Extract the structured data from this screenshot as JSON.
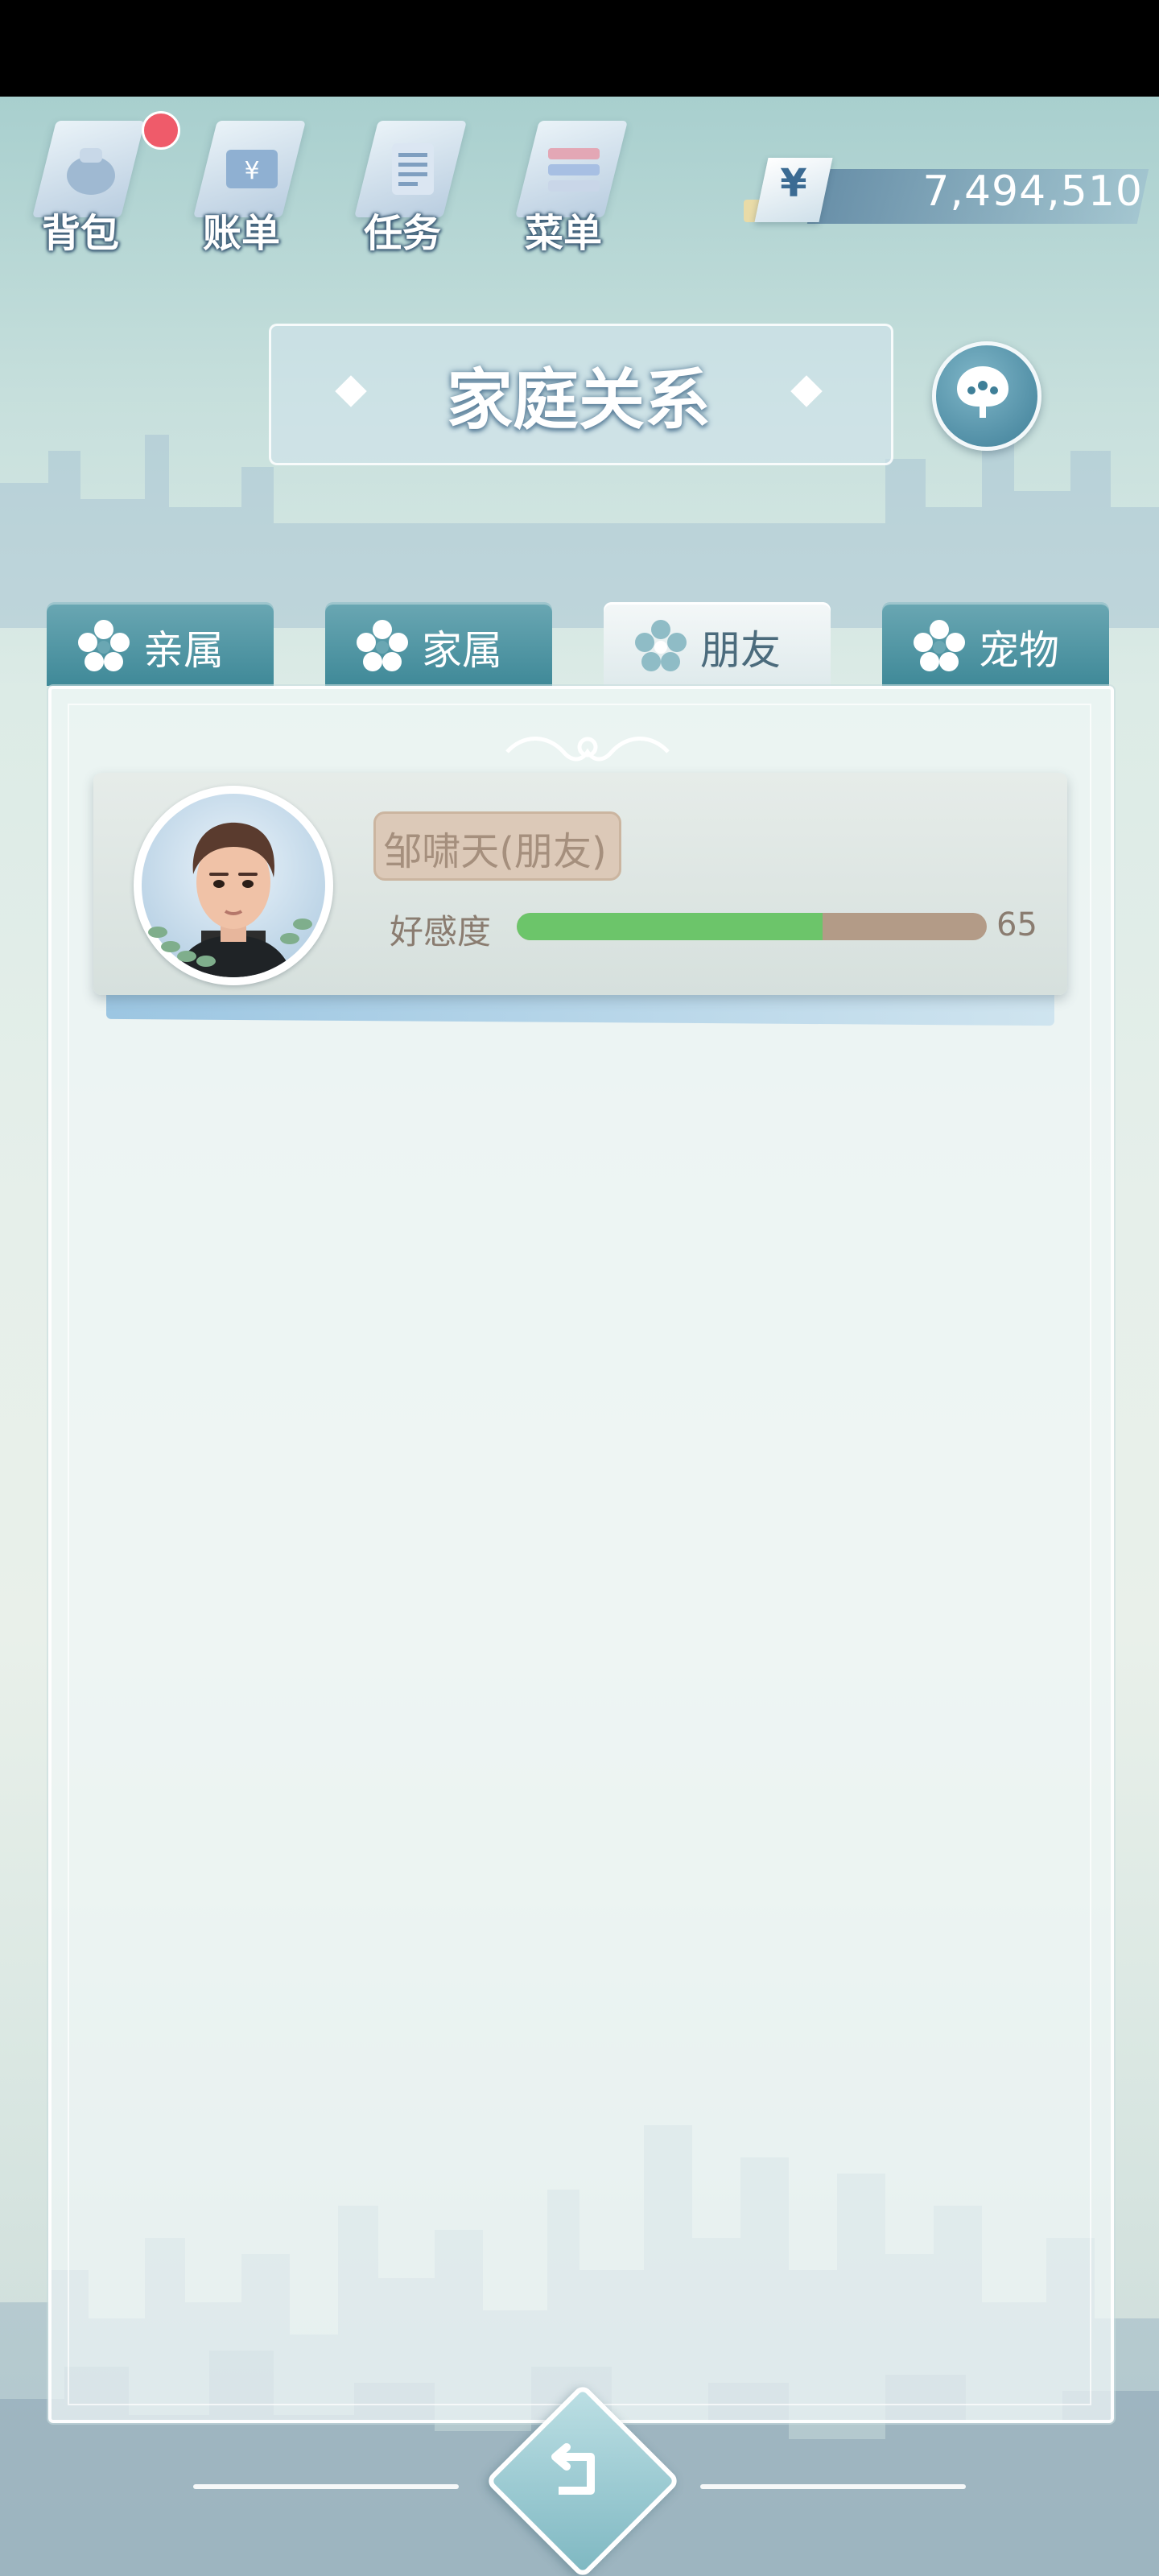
{
  "toolbar": {
    "items": [
      {
        "label": "背包",
        "icon": "backpack-icon",
        "has_notification": true
      },
      {
        "label": "账单",
        "icon": "bill-icon"
      },
      {
        "label": "任务",
        "icon": "task-icon"
      },
      {
        "label": "菜单",
        "icon": "menu-icon"
      }
    ]
  },
  "currency": {
    "symbol": "¥",
    "value": "7,494,510"
  },
  "header": {
    "title": "家庭关系"
  },
  "tabs": [
    {
      "label": "亲属",
      "active": false
    },
    {
      "label": "家属",
      "active": false
    },
    {
      "label": "朋友",
      "active": true
    },
    {
      "label": "宠物",
      "active": false
    }
  ],
  "relations": [
    {
      "name": "邹啸天(朋友)",
      "affinity_label": "好感度",
      "affinity_value": "65",
      "affinity_fraction": 0.65
    }
  ],
  "colors": {
    "tab_inactive": "#3f8998",
    "tab_active": "#f4f8f8",
    "affinity_fill": "#6cc56a",
    "affinity_track": "#b39b87",
    "notification": "#ef5b6a"
  }
}
